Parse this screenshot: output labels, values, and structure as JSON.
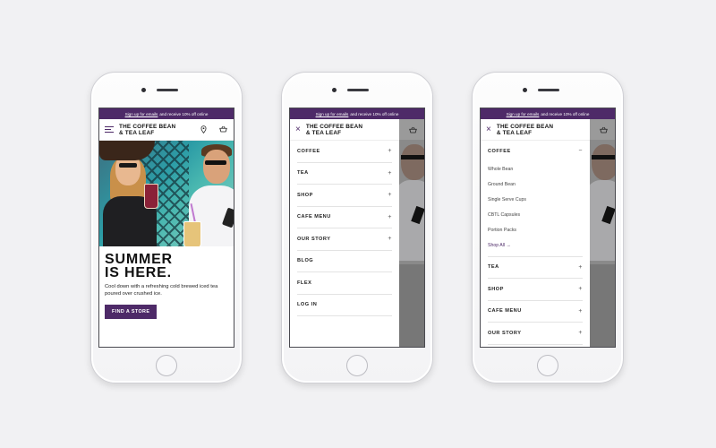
{
  "promo": {
    "link": "Sign up for emails",
    "text": "and receive 10% off online"
  },
  "brand": {
    "line1": "THE COFFEE BEAN",
    "line2": "& TEA LEAF"
  },
  "hero": {
    "headline_line1": "SUMMER",
    "headline_line2": "IS HERE.",
    "subtext": "Cool down with a refreshing cold brewed iced tea poured over crushed ice.",
    "cta": "FIND A STORE"
  },
  "icons": {
    "close": "×",
    "plus": "+",
    "minus": "−",
    "arrow": "→"
  },
  "menu_main": [
    "COFFEE",
    "TEA",
    "SHOP",
    "CAFE MENU",
    "OUR STORY",
    "BLOG",
    "FLEX",
    "LOG IN"
  ],
  "menu_expanded": {
    "open": "COFFEE",
    "sub_items": [
      "Whole Bean",
      "Ground Bean",
      "Single Serve Cups",
      "CBTL Capsules",
      "Portion Packs"
    ],
    "shop_all": "Shop All",
    "after": [
      "TEA",
      "SHOP",
      "CAFE MENU",
      "OUR STORY"
    ]
  },
  "colors": {
    "brand_purple": "#4e2a68",
    "background": "#f1f1f3"
  }
}
